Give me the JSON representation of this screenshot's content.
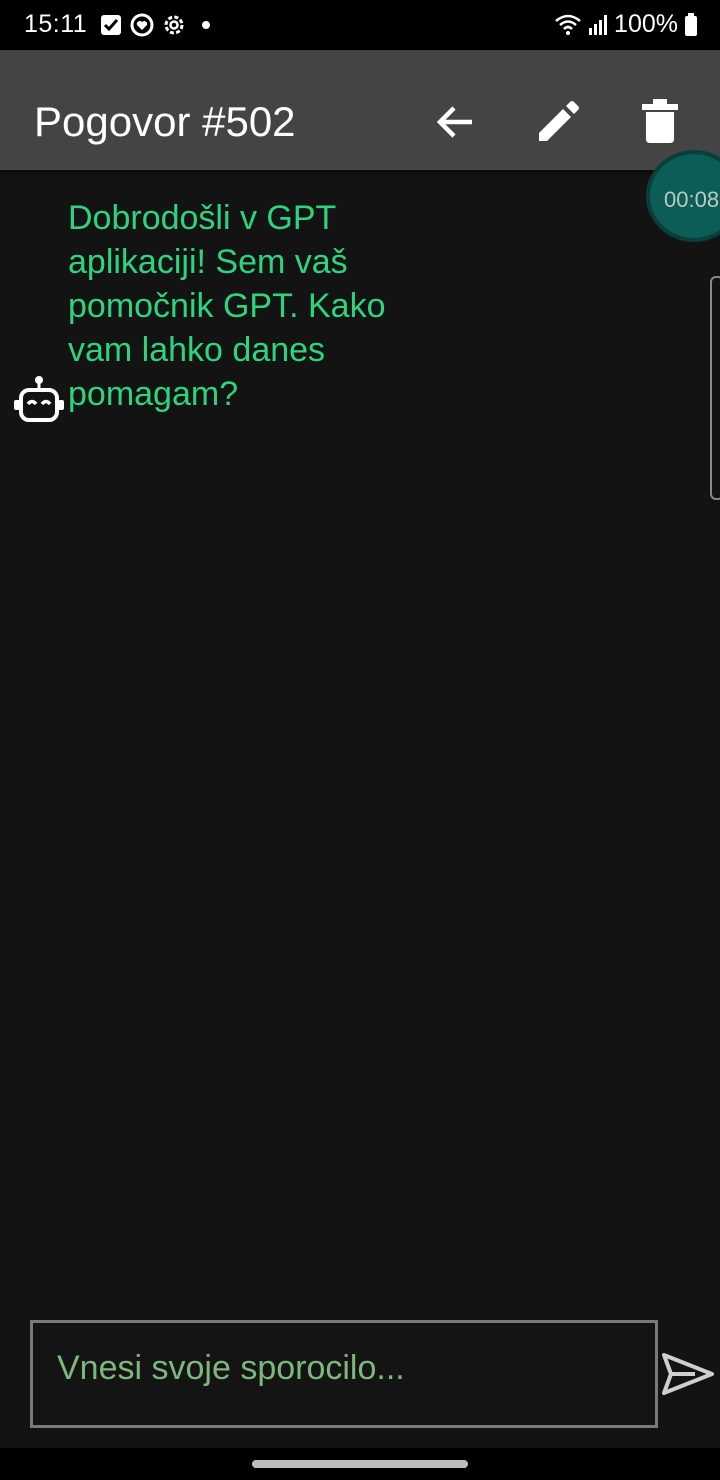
{
  "status_bar": {
    "time": "15:11",
    "battery": "100%",
    "left_icons": [
      "checkbox-icon",
      "heart-circle-icon",
      "gear-icon",
      "dot-icon"
    ],
    "right_icons": [
      "wifi-icon",
      "signal-icon",
      "battery-icon"
    ]
  },
  "app_bar": {
    "title": "Pogovor #502",
    "actions": [
      "back-arrow-icon",
      "edit-pencil-icon",
      "trash-icon"
    ]
  },
  "timer": {
    "value": "00:08"
  },
  "conversation": {
    "messages": [
      {
        "sender": "bot",
        "avatar_icon": "robot-icon",
        "text": "Dobrodošli v GPT aplikaciji! Sem vaš pomočnik GPT. Kako vam lahko danes pomagam?"
      }
    ]
  },
  "composer": {
    "placeholder": "Vnesi svoje sporocilo...",
    "send_icon": "send-icon"
  },
  "colors": {
    "app_bar": "#444444",
    "background": "#131313",
    "bot_text": "#2ed47d",
    "placeholder": "#7cb77c",
    "timer_bubble": "#0b5d55"
  }
}
